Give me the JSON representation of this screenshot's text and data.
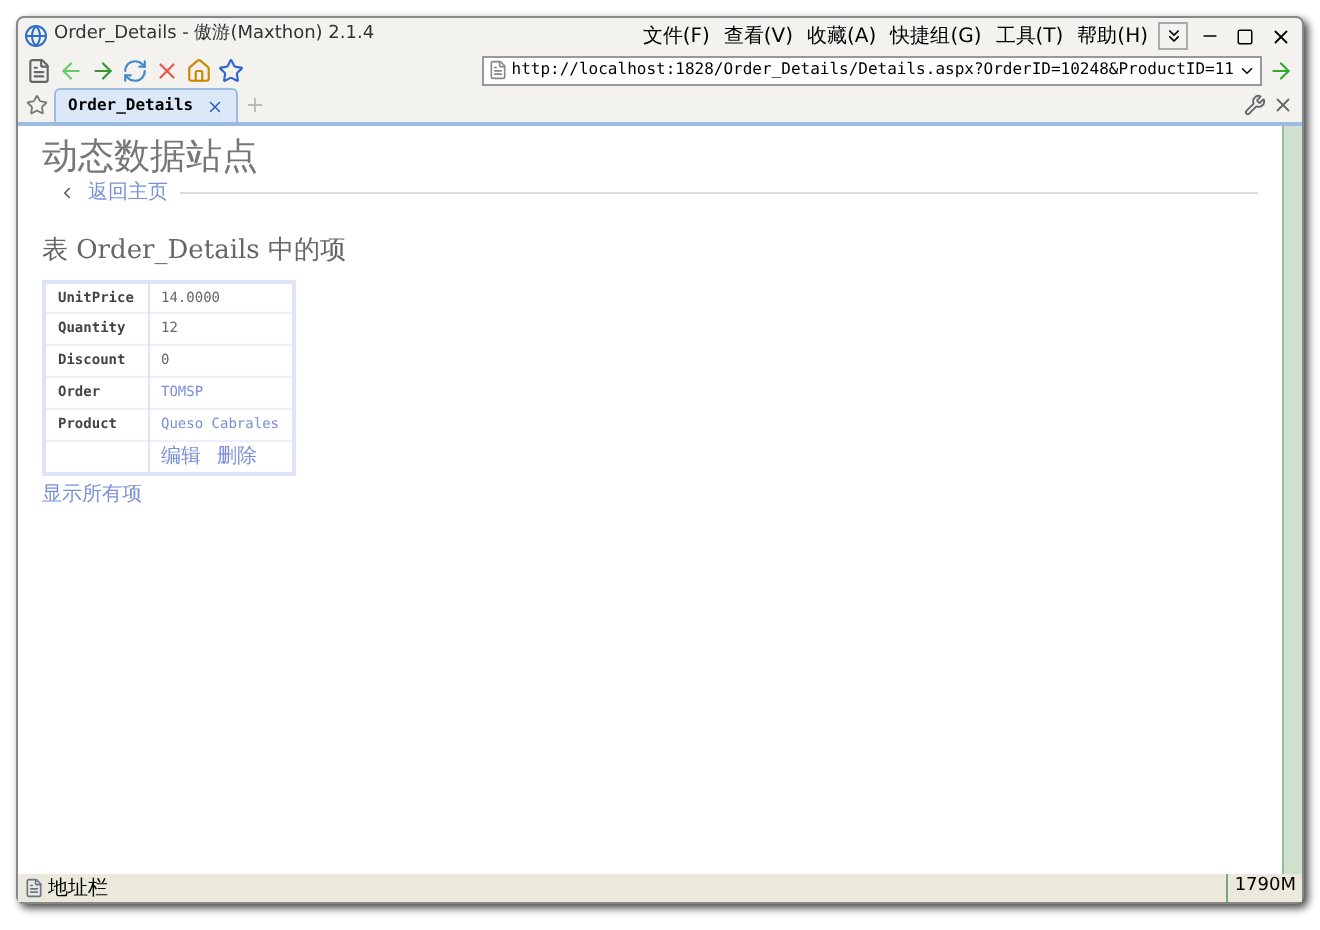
{
  "window": {
    "title": "Order_Details - 傲游(Maxthon) 2.1.4"
  },
  "menu": [
    "文件(F)",
    "查看(V)",
    "收藏(A)",
    "快捷组(G)",
    "工具(T)",
    "帮助(H)"
  ],
  "address": {
    "value": "http://localhost:1828/Order_Details/Details.aspx?OrderID=10248&ProductID=11"
  },
  "tabs": [
    {
      "label": "Order_Details",
      "selected": true
    }
  ],
  "page": {
    "site_title": "动态数据站点",
    "back_link": "返回主页",
    "heading": "表 Order_Details 中的项",
    "rows": [
      {
        "label": "UnitPrice",
        "kind": "text",
        "values": [
          "14.0000"
        ]
      },
      {
        "label": "Quantity",
        "kind": "text",
        "values": [
          "12"
        ]
      },
      {
        "label": "Discount",
        "kind": "text",
        "values": [
          "0"
        ]
      },
      {
        "label": "Order",
        "kind": "link",
        "values": [
          "TOMSP"
        ]
      },
      {
        "label": "Product",
        "kind": "link",
        "values": [
          "Queso Cabrales"
        ]
      },
      {
        "label": "",
        "kind": "actions",
        "values": [
          "编辑",
          "删除"
        ]
      }
    ],
    "show_all": "显示所有项"
  },
  "status_bar": {
    "text": "地址栏",
    "memory": "1790M"
  }
}
